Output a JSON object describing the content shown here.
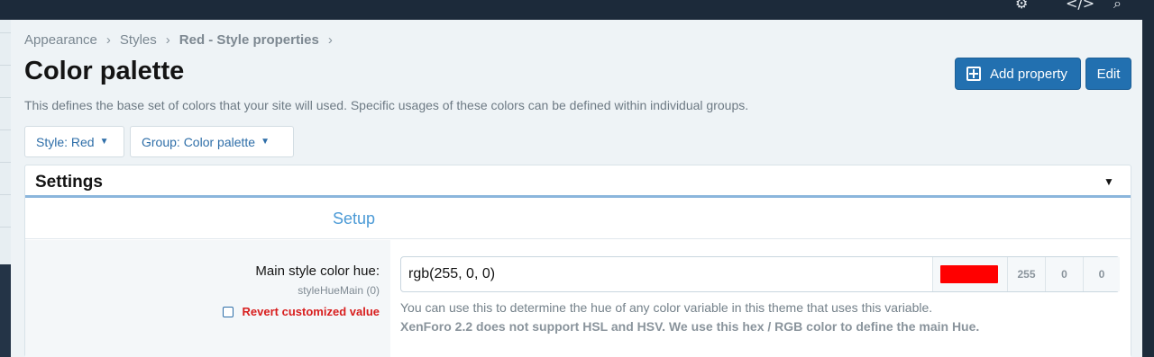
{
  "topbar": {
    "icons": [
      "settings-icon",
      "code-icon",
      "search-icon"
    ]
  },
  "breadcrumb": {
    "items": [
      "Appearance",
      "Styles",
      "Red - Style properties"
    ],
    "separator": "›"
  },
  "page": {
    "title": "Color palette",
    "description": "This defines the base set of colors that your site will used. Specific usages of these colors can be defined within individual groups."
  },
  "actions": {
    "add_property": "Add property",
    "edit": "Edit"
  },
  "filters": {
    "style": "Style: Red",
    "group": "Group: Color palette"
  },
  "panel": {
    "title": "Settings",
    "section": "Setup",
    "property": {
      "label": "Main style color hue:",
      "key": "styleHueMain (0)",
      "revert": "Revert customized value",
      "value": "rgb(255, 0, 0)",
      "swatch_color": "#ff0000",
      "r": "255",
      "g": "0",
      "b": "0",
      "hint": "You can use this to determine the hue of any color variable in this theme that uses this variable.",
      "hint_bold": "XenForo 2.2 does not support HSL and HSV. We use this hex / RGB color to define the main Hue."
    }
  },
  "colors": {
    "accent": "#2270b0",
    "link": "#2e6ea8",
    "section": "#4b9ad6",
    "revert": "#d81e1e"
  }
}
